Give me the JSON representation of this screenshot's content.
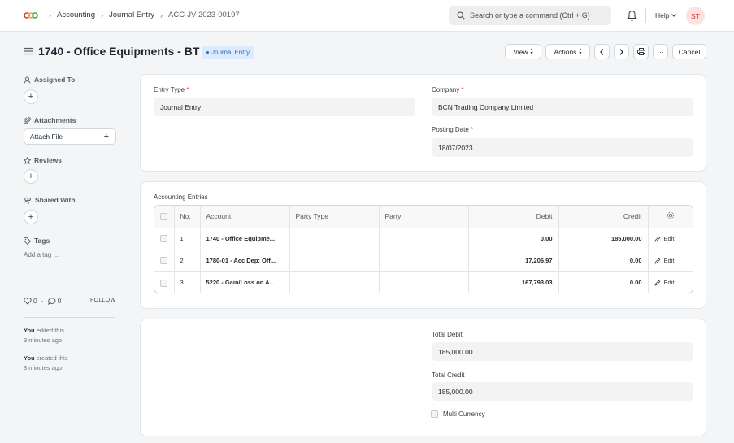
{
  "navbar": {
    "breadcrumbs": [
      "Accounting",
      "Journal Entry",
      "ACC-JV-2023-00197"
    ],
    "search_placeholder": "Search or type a command (Ctrl + G)",
    "help_label": "Help",
    "avatar_initials": "ST"
  },
  "page": {
    "title": "1740 - Office Equipments - BT",
    "badge": "Journal Entry",
    "toolbar": {
      "view": "View",
      "actions": "Actions",
      "more": "···",
      "cancel": "Cancel"
    }
  },
  "sidebar": {
    "assigned_to": "Assigned To",
    "attachments": "Attachments",
    "attach_file": "Attach File",
    "reviews": "Reviews",
    "shared_with": "Shared With",
    "tags": "Tags",
    "add_tag": "Add a tag ...",
    "likes": "0",
    "comments": "0",
    "follow": "FOLLOW",
    "activity": [
      {
        "user": "You",
        "text": " edited this",
        "time": "3 minutes ago"
      },
      {
        "user": "You",
        "text": " created this",
        "time": "3 minutes ago"
      }
    ]
  },
  "form": {
    "entry_type_label": "Entry Type",
    "entry_type_value": "Journal Entry",
    "company_label": "Company",
    "company_value": "BCN Trading Company Limited",
    "posting_date_label": "Posting Date",
    "posting_date_value": "18/07/2023",
    "required_mark": "*"
  },
  "accounts": {
    "section_label": "Accounting Entries",
    "columns": [
      "No.",
      "Account",
      "Party Type",
      "Party",
      "Debit",
      "Credit"
    ],
    "edit_label": "Edit",
    "rows": [
      {
        "no": "1",
        "account": "1740 - Office Equipme...",
        "party_type": "",
        "party": "",
        "debit": "0.00",
        "credit": "185,000.00"
      },
      {
        "no": "2",
        "account": "1780-01 - Acc Dep: Off...",
        "party_type": "",
        "party": "",
        "debit": "17,206.97",
        "credit": "0.00"
      },
      {
        "no": "3",
        "account": "5220 - Gain/Loss on A...",
        "party_type": "",
        "party": "",
        "debit": "167,793.03",
        "credit": "0.00"
      }
    ]
  },
  "totals": {
    "total_debit_label": "Total Debit",
    "total_debit_value": "185,000.00",
    "total_credit_label": "Total Credit",
    "total_credit_value": "185,000.00",
    "multi_currency_label": "Multi Currency"
  },
  "colors": {
    "accent": "#2f6fb7",
    "required": "#e03636",
    "avatar_bg": "#fde2e2"
  }
}
